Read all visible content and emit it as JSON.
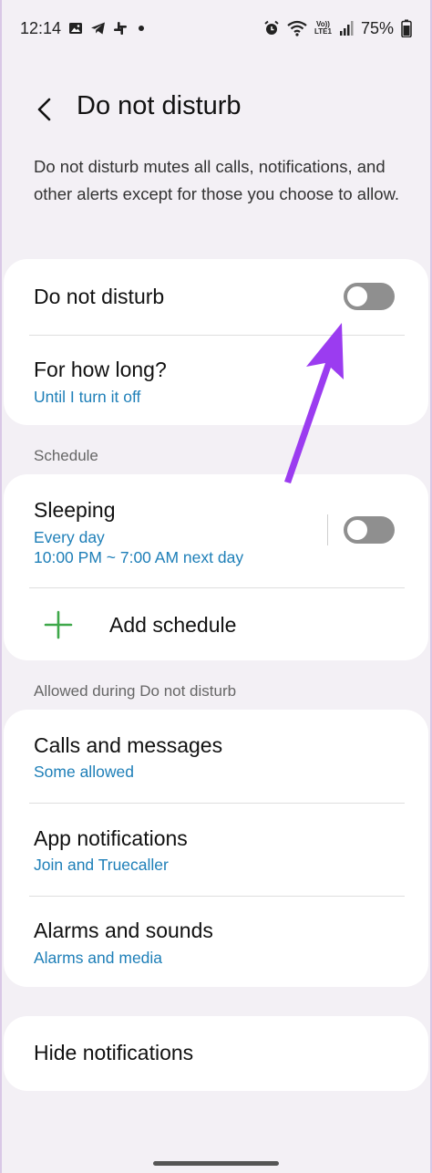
{
  "status_bar": {
    "time": "12:14",
    "battery": "75%",
    "left_icons": [
      "image-icon",
      "telegram-icon",
      "slack-icon",
      "dot-icon"
    ],
    "right_icons": [
      "alarm-icon",
      "wifi-icon",
      "volte-icon",
      "signal-icon",
      "battery-icon"
    ],
    "volte_label_top": "Vo))",
    "volte_label_bottom": "LTE1"
  },
  "header": {
    "title": "Do not disturb"
  },
  "description": "Do not disturb mutes all calls, notifications, and other alerts except for those you choose to allow.",
  "dnd_card": {
    "toggle_label": "Do not disturb",
    "toggle_on": false,
    "duration_label": "For how long?",
    "duration_value": "Until I turn it off"
  },
  "schedule": {
    "section_label": "Schedule",
    "items": [
      {
        "title": "Sleeping",
        "days": "Every day",
        "time": "10:00 PM ~ 7:00 AM next day",
        "enabled": false
      }
    ],
    "add_label": "Add schedule"
  },
  "allowed": {
    "section_label": "Allowed during Do not disturb",
    "items": [
      {
        "title": "Calls and messages",
        "subtitle": "Some allowed"
      },
      {
        "title": "App notifications",
        "subtitle": "Join and Truecaller"
      },
      {
        "title": "Alarms and sounds",
        "subtitle": "Alarms and media"
      }
    ]
  },
  "hide_notifications": {
    "label": "Hide notifications"
  },
  "colors": {
    "background": "#f3f0f5",
    "card": "#ffffff",
    "accent_blue": "#1e7fb8",
    "add_green": "#3ea84a",
    "toggle_off": "#8f8f8f",
    "annotation_arrow": "#9b3cf0"
  }
}
